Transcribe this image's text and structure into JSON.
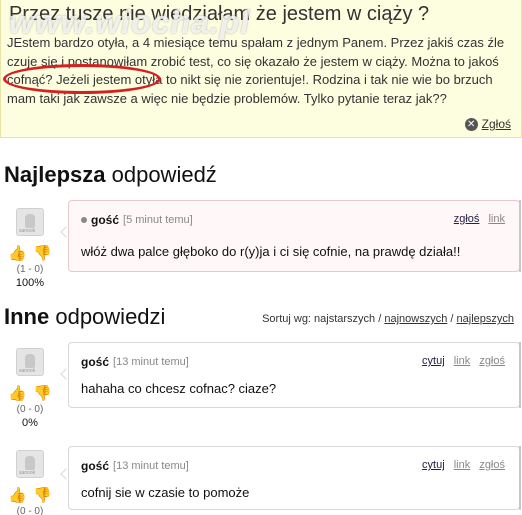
{
  "watermark": "www.wiocha.pl",
  "question": {
    "title": "Przez tusze nie wiedziałam że jestem w ciąży ?",
    "body": "JEstem bardzo otyła, a 4 miesiące temu spałam z jednym Panem. Przez jakiś czas źle czuje się i postanowiłam zrobić test, co się okazało że jestem w ciąży. Można to jakoś cofnąć? Jeżeli jestem otyła to nikt się nie zorientuje!. Rodzina i tak nie wie bo brzuch mam taki jak zawsze a więc nie będzie problemów. Tylko pytanie teraz jak??",
    "report_label": "Zgłoś"
  },
  "best": {
    "title_bold": "Najlepsza",
    "title_rest": " odpowiedź",
    "author": "gość",
    "time": "[5 minut temu]",
    "actions": [
      "zgłoś",
      "link"
    ],
    "text": "włóż dwa palce głęboko do r(y)ja i ci się cofnie, na prawdę działa!!",
    "votes": "(1 - 0)",
    "percent": "100%"
  },
  "others": {
    "title_bold": "Inne",
    "title_rest": " odpowiedzi",
    "sort_label": "Sortuj wg: najstarszych / ",
    "sort_newest": "najnowszych",
    "sort_sep": " / ",
    "sort_best": "najlepszych",
    "answers": [
      {
        "author": "gość",
        "time": "[13 minut temu]",
        "actions": [
          "cytuj",
          "link",
          "zgłoś"
        ],
        "text": "hahaha co chcesz cofnac? ciaze?",
        "votes": "(0 - 0)",
        "percent": "0%"
      },
      {
        "author": "gość",
        "time": "[13 minut temu]",
        "actions": [
          "cytuj",
          "link",
          "zgłoś"
        ],
        "text": "cofnij sie w czasie to pomoże",
        "votes": "(0 - 0)"
      }
    ]
  },
  "avatar_caption": "sanook",
  "icons": {
    "thumb_up": "👍",
    "thumb_down": "👎",
    "close": "✕"
  }
}
